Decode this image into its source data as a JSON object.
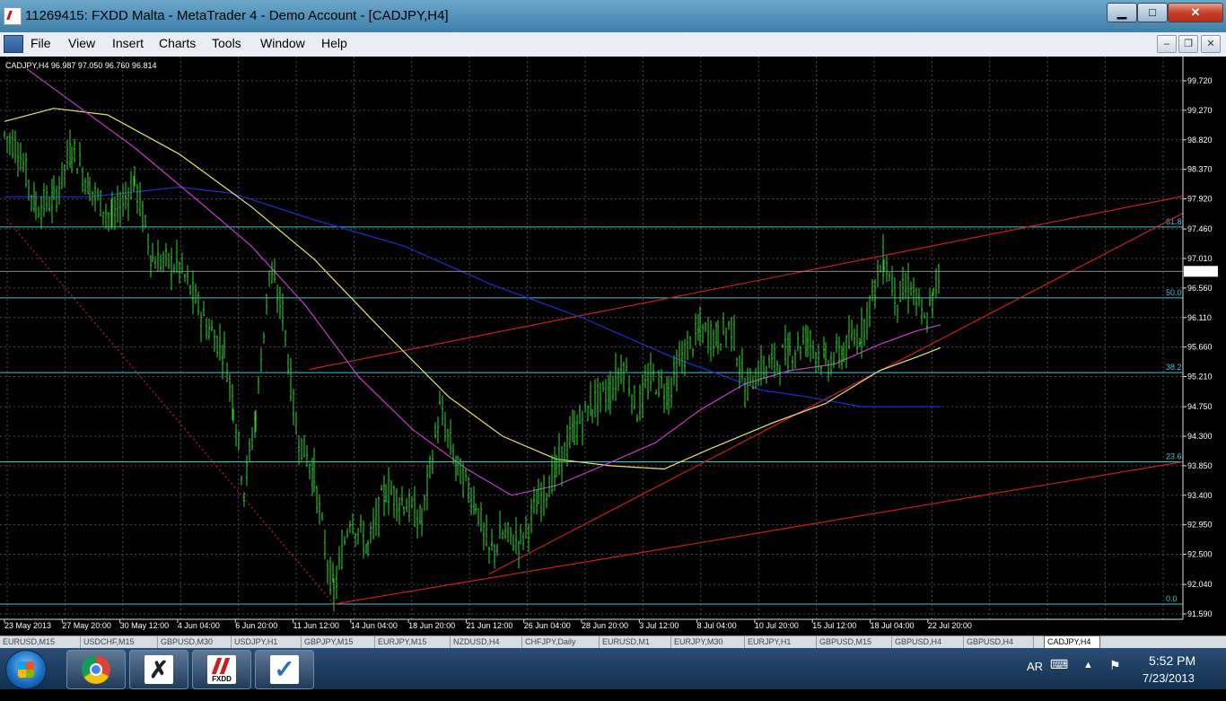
{
  "window": {
    "title": "11269415: FXDD Malta - MetaTrader 4 - Demo Account - [CADJPY,H4]",
    "minimize_label": "▁",
    "maximize_label": "□",
    "close_label": "✕"
  },
  "menu": {
    "items": [
      "File",
      "View",
      "Insert",
      "Charts",
      "Tools",
      "Window",
      "Help"
    ],
    "mdi_minimize": "‒",
    "mdi_restore": "❐",
    "mdi_close": "✕"
  },
  "chart": {
    "header": "CADJPY,H4  96.987 97.050 96.760 96.814",
    "current_price": "96.814",
    "price_labels": [
      "99.720",
      "99.270",
      "98.820",
      "98.370",
      "97.920",
      "97.460",
      "97.010",
      "96.560",
      "96.110",
      "95.660",
      "95.210",
      "94.750",
      "94.300",
      "93.850",
      "93.400",
      "92.950",
      "92.500",
      "92.040",
      "91.590"
    ],
    "time_labels": [
      "23 May 2013",
      "27 May 20:00",
      "30 May 12:00",
      "4 Jun 04:00",
      "6 Jun 20:00",
      "11 Jun 12:00",
      "14 Jun 04:00",
      "18 Jun 20:00",
      "21 Jun 12:00",
      "26 Jun 04:00",
      "28 Jun 20:00",
      "3 Jul 12:00",
      "8 Jul 04:00",
      "10 Jul 20:00",
      "15 Jul 12:00",
      "18 Jul 04:00",
      "22 Jul 20:00"
    ],
    "fib_levels": [
      {
        "label": "61.8",
        "price": 97.49
      },
      {
        "label": "50.0",
        "price": 96.41
      },
      {
        "label": "38.2",
        "price": 95.27
      },
      {
        "label": "23.6",
        "price": 93.91
      },
      {
        "label": "0.0",
        "price": 91.74
      }
    ],
    "colors": {
      "background": "#000000",
      "grid": "#4a4a4a",
      "candles": "#2cd62c",
      "fib": "#3cc6d0",
      "trendline": "#c81e1e",
      "ma_blue": "#1d2fd0",
      "ma_yellow": "#e8e46a",
      "ma_magenta": "#c43cc8"
    }
  },
  "tabs": {
    "items": [
      "EURUSD,M15",
      "USDCHF,M15",
      "GBPUSD,M30",
      "USDJPY,H1",
      "GBPJPY,M15",
      "EURJPY,M15",
      "NZDUSD,H4",
      "CHFJPY,Daily",
      "EURUSD,M1",
      "EURJPY,M30",
      "EURJPY,H1",
      "GBPUSD,M15",
      "GBPUSD,H4",
      "GBPUSD,H4",
      "CADJPY,H4"
    ],
    "active_index": 14
  },
  "taskbar": {
    "apps": [
      "chrome-icon",
      "xtrade-icon",
      "fxdd-icon",
      "checkmark-icon"
    ],
    "fxdd_label": "FXDD",
    "x_glyph": "✗",
    "check_glyph": "✓",
    "language": "AR",
    "time": "5:52 PM",
    "date": "7/23/2013"
  }
}
